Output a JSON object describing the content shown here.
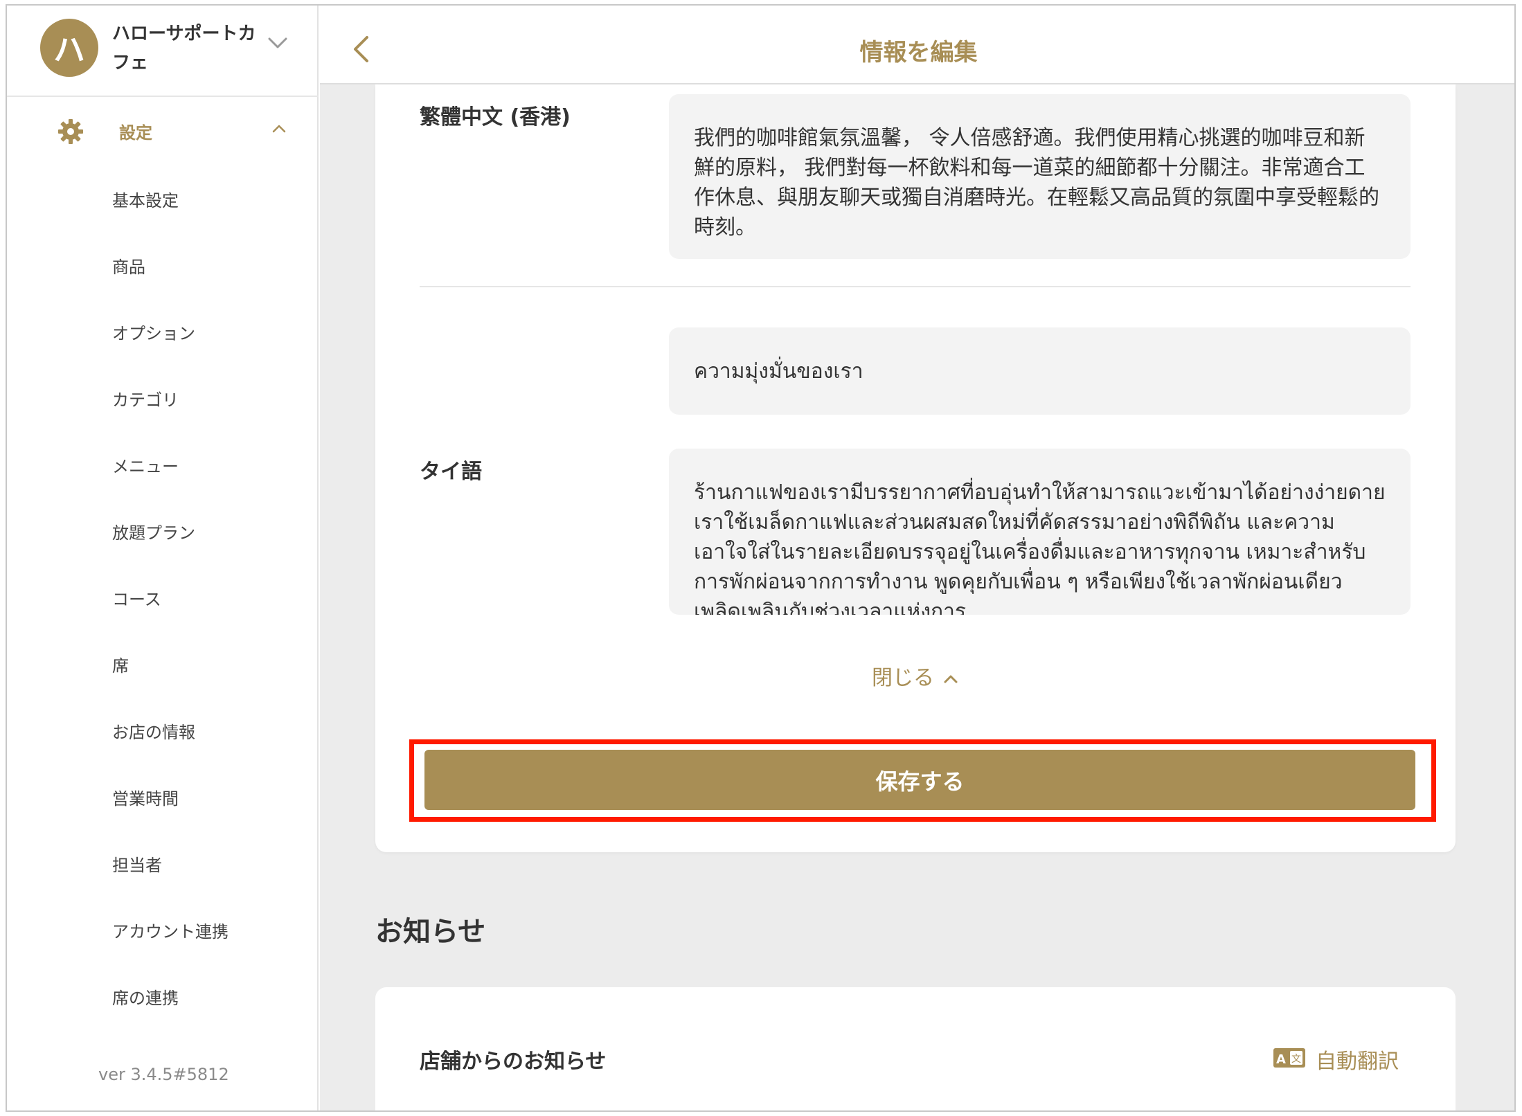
{
  "account": {
    "avatar_initial": "ハ",
    "store_name": "ハローサポートカフェ"
  },
  "sidebar": {
    "section_label": "設定",
    "items": [
      {
        "label": "基本設定"
      },
      {
        "label": "商品"
      },
      {
        "label": "オプション"
      },
      {
        "label": "カテゴリ"
      },
      {
        "label": "メニュー"
      },
      {
        "label": "放題プラン"
      },
      {
        "label": "コース"
      },
      {
        "label": "席"
      },
      {
        "label": "お店の情報"
      },
      {
        "label": "営業時間"
      },
      {
        "label": "担当者"
      },
      {
        "label": "アカウント連携"
      },
      {
        "label": "席の連携"
      }
    ],
    "version": "ver 3.4.5#5812"
  },
  "header": {
    "title": "情報を編集"
  },
  "form": {
    "zh_hk": {
      "label": "繁體中文 (香港)",
      "description": "我們的咖啡館氣氛溫馨， 令人倍感舒適。我們使用精心挑選的咖啡豆和新鮮的原料， 我們對每一杯飲料和每一道菜的細節都十分關注。非常適合工作休息、與朋友聊天或獨自消磨時光。在輕鬆又高品質的氛圍中享受輕鬆的時刻。"
    },
    "thai": {
      "label": "タイ語",
      "title": "ความมุ่งมั่นของเรา",
      "description": "ร้านกาแฟของเรามีบรรยากาศที่อบอุ่นทำให้สามารถแวะเข้ามาได้อย่างง่ายดาย เราใช้เมล็ดกาแฟและส่วนผสมสดใหม่ที่คัดสรรมาอย่างพิถีพิถัน และความเอาใจใส่ในรายละเอียดบรรจุอยู่ในเครื่องดื่มและอาหารทุกจาน เหมาะสำหรับการพักผ่อนจากการทำงาน พูดคุยกับเพื่อน ๆ หรือเพียงใช้เวลาพักผ่อนเดียว เพลิดเพลินกับช่วงเวลาแห่งการ"
    },
    "close_label": "閉じる",
    "save_label": "保存する"
  },
  "notices": {
    "heading": "お知らせ",
    "card_title": "店舗からのお知らせ",
    "auto_translate_label": "自動翻訳"
  },
  "colors": {
    "accent": "#a88e55",
    "highlight": "#ff1a00"
  }
}
